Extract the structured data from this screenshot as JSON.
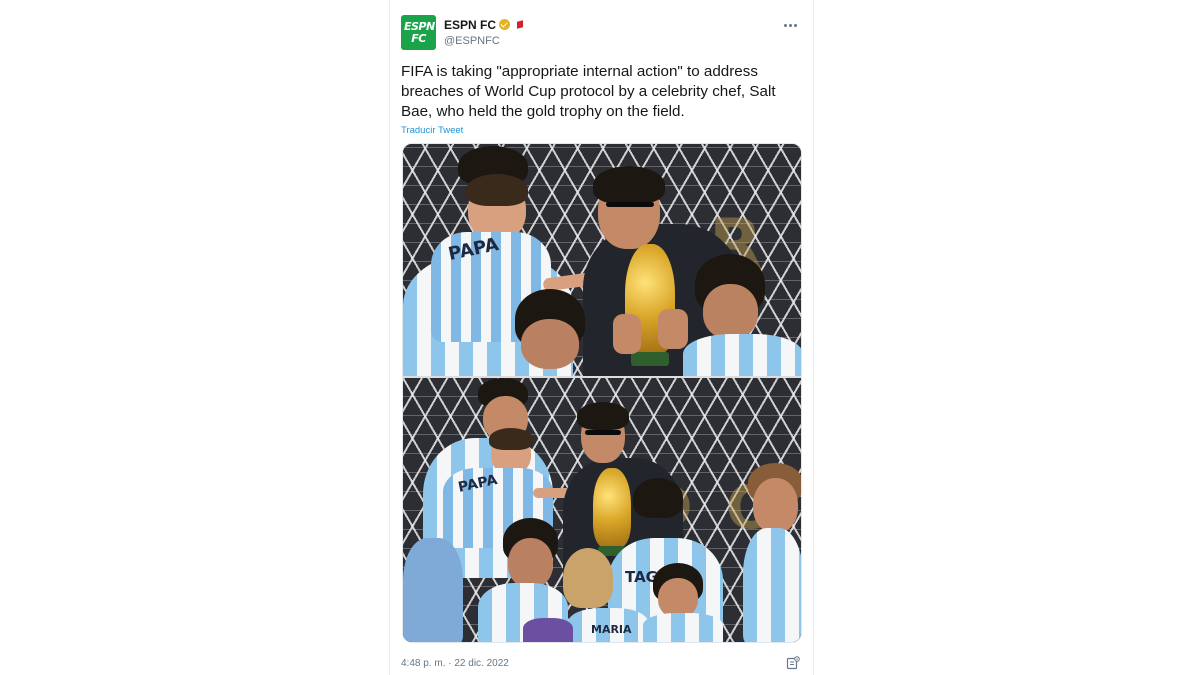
{
  "tweet": {
    "display_name": "ESPN FC",
    "handle": "@ESPNFC",
    "avatar_text_top": "ESPN",
    "avatar_text_bottom": "FC",
    "text": "FIFA is taking \"appropriate internal action\" to address breaches of World Cup protocol by a celebrity chef, Salt Bae, who held the gold trophy on the field.",
    "translate_label": "Traducir Tweet",
    "timestamp": "4:48 p. m. · 22 dic. 2022"
  },
  "media": {
    "top_photo_jersey_text": "PAPA",
    "bottom_photo_jersey_text_1": "PAPA",
    "bottom_photo_jersey_text_2": "TAGL",
    "bottom_photo_jersey_text_3": "MARIA"
  },
  "icons": {
    "verified": "verified-badge-icon",
    "affiliate": "affiliate-flag-icon",
    "more": "more-options-icon",
    "info": "tweet-info-icon"
  },
  "colors": {
    "avatar_bg": "#1aa34a",
    "link": "#1b95e0",
    "text": "#14171a",
    "muted": "#657786",
    "verified": "#e6b422"
  }
}
